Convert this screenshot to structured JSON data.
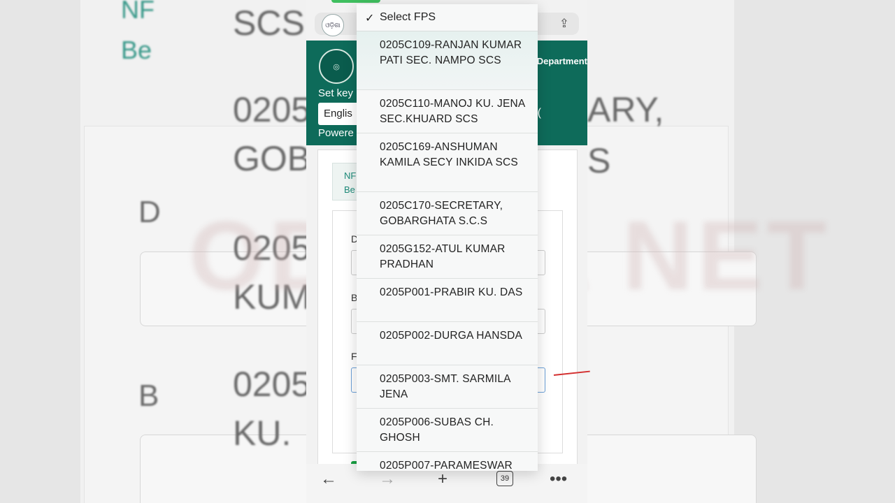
{
  "background": {
    "fragments": [
      "NF",
      "Be",
      "SCS",
      "0205",
      "GOB",
      "D",
      "0205",
      "KUM",
      "0205",
      "B",
      "KU.",
      "ARY,",
      "S"
    ],
    "watermark": "ODISHA NET"
  },
  "browser": {
    "site_icon_label": "ଓଡ଼ିଶା",
    "tabs_count": "39"
  },
  "header": {
    "department": "Department",
    "set_keyboard": "Set key",
    "language": "Englis",
    "powered_by": "Powere",
    "paren": "("
  },
  "content": {
    "nf_line1": "NF",
    "nf_line2": "Be",
    "field_labels": [
      "D",
      "B",
      "F"
    ]
  },
  "dropdown": {
    "selected": "Select FPS",
    "options": [
      "0205C109-RANJAN KUMAR PATI SEC. NAMPO SCS",
      "0205C110-MANOJ KU. JENA SEC.KHUARD SCS",
      "0205C169-ANSHUMAN KAMILA SECY INKIDA SCS",
      "0205C170-SECRETARY, GOBARGHATA S.C.S",
      "0205G152-ATUL KUMAR PRADHAN",
      "0205P001-PRABIR KU. DAS",
      "0205P002-DURGA HANSDA",
      "0205P003-SMT. SARMILA JENA",
      "0205P006-SUBAS CH. GHOSH",
      "0205P007-PARAMESWAR"
    ]
  },
  "colors": {
    "header_green": "#0e6b5a",
    "button_green": "#18a043",
    "annotation_red": "#d32f2f"
  }
}
